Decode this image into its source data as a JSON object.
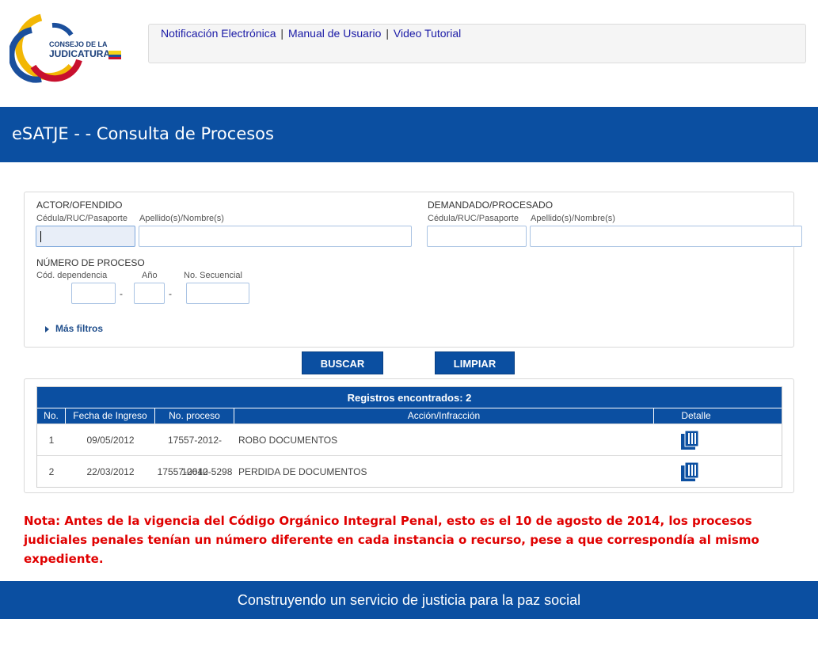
{
  "brand": {
    "logo_line1": "CONSEJO DE LA",
    "logo_line2": "JUDICATURA"
  },
  "topnav": {
    "links": [
      "Notificación Electrónica",
      "Manual de Usuario",
      "Video Tutorial"
    ],
    "separator": "|"
  },
  "header": {
    "title": "eSATJE - - Consulta de Procesos"
  },
  "search": {
    "actor": {
      "title": "ACTOR/OFENDIDO",
      "id_label": "Cédula/RUC/Pasaporte",
      "name_label": "Apellido(s)/Nombre(s)",
      "id_value": "",
      "name_value": ""
    },
    "demandado": {
      "title": "DEMANDADO/PROCESADO",
      "id_label": "Cédula/RUC/Pasaporte",
      "name_label": "Apellido(s)/Nombre(s)",
      "id_value": "",
      "name_value": ""
    },
    "numero": {
      "title": "NÚMERO DE PROCESO",
      "dep_label": "Cód. dependencia",
      "anio_label": "Año",
      "sec_label": "No. Secuencial",
      "dash": "-"
    },
    "more_filters": "Más filtros",
    "buscar_label": "BUSCAR",
    "limpiar_label": "LIMPIAR"
  },
  "results": {
    "title": "Registros encontrados: 2",
    "columns": [
      "No.",
      "Fecha de Ingreso",
      "No. proceso",
      "Acción/Infracción",
      "Detalle"
    ],
    "rows": [
      {
        "no": "1",
        "fecha": "09/05/2012",
        "proceso": "17557-2012-10640",
        "accion": "ROBO DOCUMENTOS",
        "detalle_icon": "document-detail-icon"
      },
      {
        "no": "2",
        "fecha": "22/03/2012",
        "proceso": "17557-2012-5298",
        "accion": "PERDIDA DE DOCUMENTOS",
        "detalle_icon": "document-detail-icon"
      }
    ]
  },
  "note": {
    "text": "Nota: Antes de la vigencia del Código Orgánico Integral Penal, esto es el 10 de agosto de 2014, los procesos judiciales penales tenían un número diferente en cada instancia o recurso, pese a que correspondía al mismo expediente."
  },
  "footer": {
    "text": "Construyendo un servicio de justicia para la paz social"
  },
  "colors": {
    "primary_blue": "#0b4fa1",
    "note_red": "#e00000",
    "link_blue": "#1a1aa6"
  }
}
